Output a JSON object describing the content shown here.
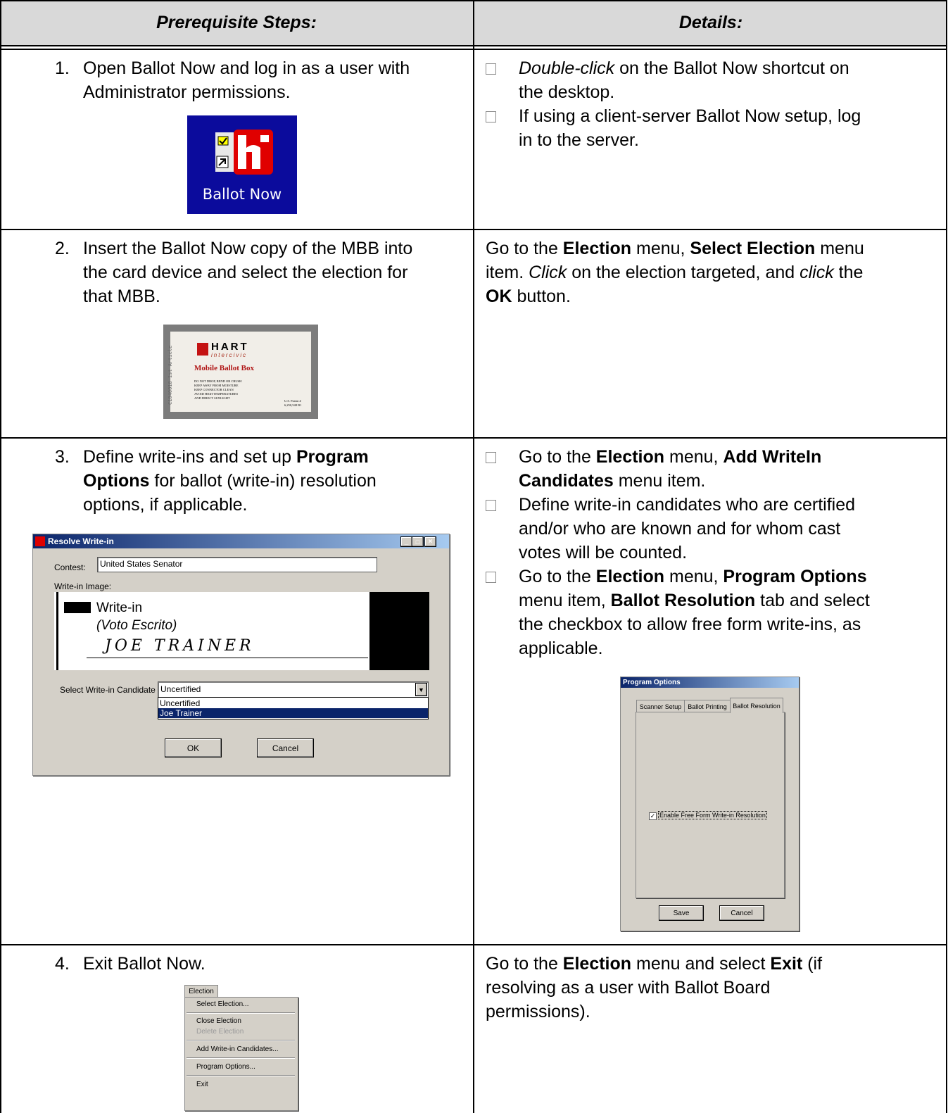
{
  "header": {
    "col1": "Prerequisite Steps:",
    "col2": "Details:"
  },
  "rows": [
    {
      "number": "1.",
      "step_lines": [
        "Open Ballot Now and log in as a user with",
        "Administrator permissions."
      ],
      "icon_label": "Ballot Now",
      "details": [
        {
          "a": "Double-click",
          "b": " on the Ballot Now shortcut on"
        },
        {
          "a": "the desktop."
        },
        {
          "a": "If using a client-server Ballot Now setup, log"
        },
        {
          "a": "in to the server."
        }
      ]
    },
    {
      "number": "2.",
      "step_lines": [
        "Insert the Ballot Now copy of the MBB into",
        "the card device and select the election for",
        "that MBB."
      ],
      "card": {
        "brand": "HART",
        "sub": "intercivic",
        "title": "Mobile Ballot Box",
        "side": "C1040018 1st Article",
        "warnings": [
          "DO NOT DROP, BEND OR CRUSH",
          "KEEP AWAY FROM MOISTURE",
          "KEEP CONNECTOR CLEAN",
          "AVOID HIGH TEMPERATURES",
          "AND DIRECT SUNLIGHT"
        ],
        "patent": "U.S. Patent #",
        "patent_no": "6,250,548 B1"
      },
      "details": {
        "l1a": "Go to the ",
        "l1b": "Election",
        "l1c": " menu, ",
        "l1d": "Select Election",
        "l1e": " menu",
        "l2a": "item. ",
        "l2b": "Click",
        "l2c": " on the election targeted, and ",
        "l2d": "click",
        "l2e": " the",
        "l3a": "OK",
        "l3b": " button."
      }
    },
    {
      "number": "3.",
      "step": {
        "l1a": "Define write-ins and set up ",
        "l1b": "Program",
        "l2a": "Options",
        "l2b": " for ballot (write-in) resolution",
        "l3": "options, if applicable."
      },
      "dialog": {
        "title": "Resolve Write-in",
        "contest_label": "Contest:",
        "contest_value": "United States Senator",
        "image_label": "Write-in Image:",
        "writein": "Write-in",
        "voto": "(Voto Escrito)",
        "handwriting": "JOE TRAINER",
        "select_label": "Select Write-in Candidate",
        "select_value": "Uncertified",
        "options": [
          "Uncertified",
          "Joe Trainer"
        ],
        "ok": "OK",
        "cancel": "Cancel"
      },
      "details": {
        "b1a": "Go to the ",
        "b1b": "Election",
        "b1c": " menu, ",
        "b1d": "Add WriteIn",
        "b1e": "Candidates",
        "b1f": " menu item.",
        "b2": [
          "Define write-in candidates who are certified",
          "and/or who are known and for whom cast",
          "votes will be counted."
        ],
        "b3a": "Go to the ",
        "b3b": "Election",
        "b3c": " menu, ",
        "b3d": "Program Options",
        "b3e": "menu item, ",
        "b3f": "Ballot Resolution",
        "b3g": " tab and select",
        "b3h": "the checkbox to allow free form write-ins, as",
        "b3i": "applicable."
      },
      "program_options": {
        "title": "Program Options",
        "tabs": [
          "Scanner Setup",
          "Ballot Printing",
          "Ballot Resolution"
        ],
        "checkbox_label": "Enable Free Form Write-in Resolution",
        "checked": true,
        "save": "Save",
        "cancel": "Cancel"
      }
    },
    {
      "number": "4.",
      "step": "Exit Ballot Now.",
      "menu": {
        "title": "Election",
        "items": [
          "Select Election...",
          "Close Election",
          "Delete Election",
          "Add Write-in Candidates...",
          "Program Options...",
          "Exit"
        ]
      },
      "details": {
        "l1a": "Go to the ",
        "l1b": "Election",
        "l1c": " menu and select ",
        "l1d": "Exit",
        "l1e": " (if",
        "l2": "resolving as a user with Ballot Board",
        "l3": "permissions)."
      }
    }
  ]
}
